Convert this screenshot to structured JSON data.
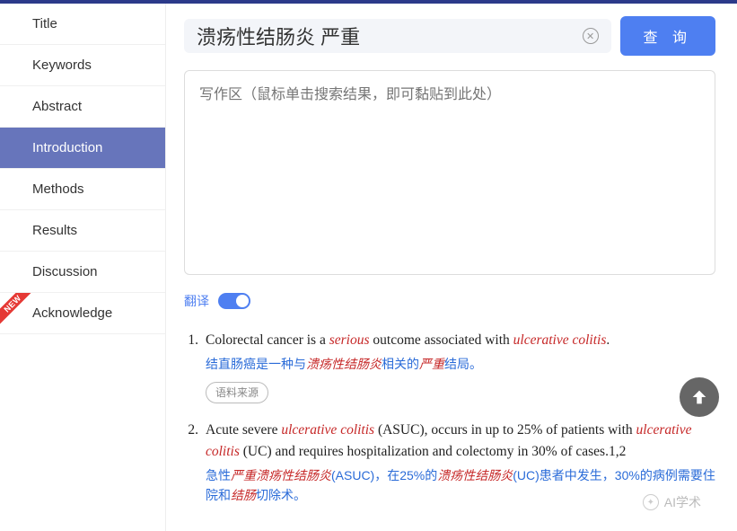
{
  "sidebar": {
    "items": [
      {
        "label": "Title"
      },
      {
        "label": "Keywords"
      },
      {
        "label": "Abstract"
      },
      {
        "label": "Introduction"
      },
      {
        "label": "Methods"
      },
      {
        "label": "Results"
      },
      {
        "label": "Discussion"
      },
      {
        "label": "Acknowledge",
        "ribbon": "NEW"
      }
    ],
    "active_index": 3
  },
  "search": {
    "value": "溃疡性结肠炎 严重",
    "query_button": "查 询"
  },
  "writing_area": {
    "placeholder": "写作区（鼠标单击搜索结果，即可黏贴到此处）"
  },
  "translate": {
    "label": "翻译",
    "on": true
  },
  "results": [
    {
      "num": "1.",
      "en_parts": [
        {
          "t": "Colorectal cancer is a "
        },
        {
          "t": "serious",
          "hl": true
        },
        {
          "t": " outcome associated with "
        },
        {
          "t": "ulcerative colitis",
          "hl": true
        },
        {
          "t": "."
        }
      ],
      "zh_parts": [
        {
          "t": "结直肠癌是一种与"
        },
        {
          "t": "溃疡性结肠炎",
          "hl": true
        },
        {
          "t": "相关的"
        },
        {
          "t": "严重",
          "hl": true
        },
        {
          "t": "结局。"
        }
      ],
      "source_label": "语料来源"
    },
    {
      "num": "2.",
      "en_parts": [
        {
          "t": "Acute severe "
        },
        {
          "t": "ulcerative colitis",
          "hl": true
        },
        {
          "t": " (ASUC), occurs in up to 25% of patients with "
        },
        {
          "t": "ulcerative colitis",
          "hl": true
        },
        {
          "t": " (UC) and requires hospitalization and colectomy in 30% of cases.1,2"
        }
      ],
      "zh_parts": [
        {
          "t": "急性"
        },
        {
          "t": "严重溃疡性结肠炎",
          "hl": true
        },
        {
          "t": "(ASUC)，在25%的"
        },
        {
          "t": "溃疡性结肠炎",
          "hl": true
        },
        {
          "t": "(UC)患者中发生，30%的病例需要住院和"
        },
        {
          "t": "结肠",
          "hl": true
        },
        {
          "t": "切除术。"
        }
      ]
    }
  ],
  "watermark": {
    "text": "AI学术"
  }
}
